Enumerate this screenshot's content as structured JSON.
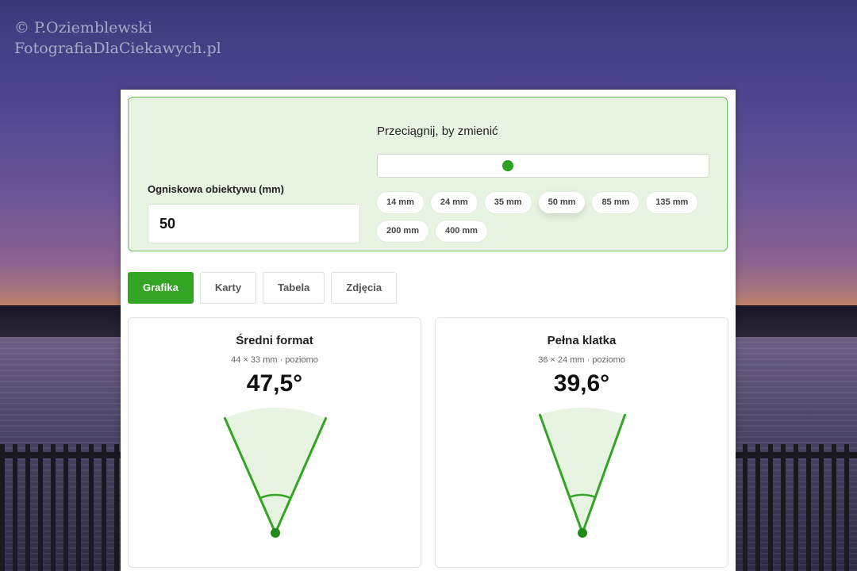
{
  "watermark": {
    "line1": "© P.Oziemblewski",
    "line2": "FotografiaDlaCiekawych.pl"
  },
  "controls": {
    "focal_label": "Ogniskowa obiektywu (mm)",
    "focal_value": "50",
    "drag_label": "Przeciągnij, by zmienić",
    "slider": {
      "value": 50,
      "min": 14,
      "max": 400
    },
    "presets": [
      {
        "label": "14 mm",
        "active": false
      },
      {
        "label": "24 mm",
        "active": false
      },
      {
        "label": "35 mm",
        "active": false
      },
      {
        "label": "50 mm",
        "active": true
      },
      {
        "label": "85 mm",
        "active": false
      },
      {
        "label": "135 mm",
        "active": false
      },
      {
        "label": "200 mm",
        "active": false
      },
      {
        "label": "400 mm",
        "active": false
      }
    ]
  },
  "tabs": [
    {
      "label": "Grafika",
      "active": true
    },
    {
      "label": "Karty",
      "active": false
    },
    {
      "label": "Tabela",
      "active": false
    },
    {
      "label": "Zdjęcia",
      "active": false
    }
  ],
  "cards": [
    {
      "title": "Średni format",
      "subtitle": "44 × 33 mm · poziomo",
      "angle_text": "47,5°",
      "angle_deg": 47.5
    },
    {
      "title": "Pełna klatka",
      "subtitle": "36 × 24 mm · poziomo",
      "angle_text": "39,6°",
      "angle_deg": 39.6
    }
  ],
  "colors": {
    "accent": "#33a424",
    "fov_fill": "#e7f4e1",
    "control_bg": "#e7f4e1"
  }
}
